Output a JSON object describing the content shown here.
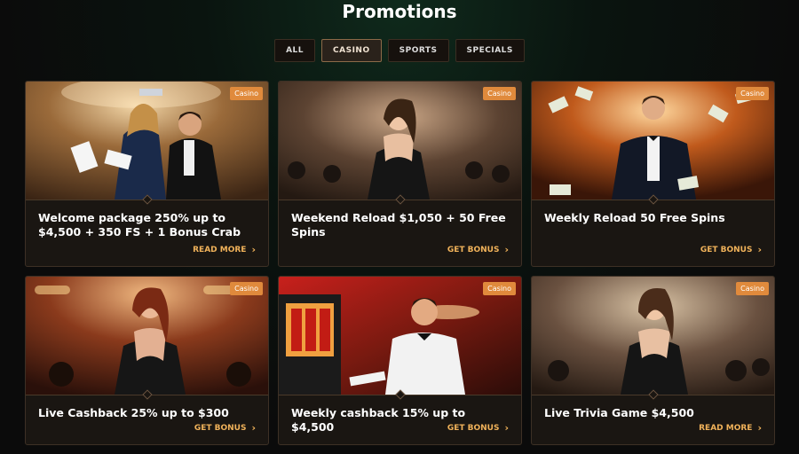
{
  "page": {
    "title": "Promotions"
  },
  "tabs": [
    {
      "label": "ALL"
    },
    {
      "label": "CASINO"
    },
    {
      "label": "SPORTS"
    },
    {
      "label": "SPECIALS"
    }
  ],
  "cards": [
    {
      "badge": "Casino",
      "title": "Welcome package 250% up to $4,500 + 350 FS + 1 Bonus Crab",
      "action": "READ MORE"
    },
    {
      "badge": "Casino",
      "title": "Weekend Reload $1,050 + 50 Free Spins",
      "action": "GET BONUS"
    },
    {
      "badge": "Casino",
      "title": "Weekly Reload 50 Free Spins",
      "action": "GET BONUS"
    },
    {
      "badge": "Casino",
      "title": "Live Cashback 25% up to $300",
      "action": "GET BONUS"
    },
    {
      "badge": "Casino",
      "title": "Weekly cashback 15% up to $4,500",
      "action": "GET BONUS"
    },
    {
      "badge": "Casino",
      "title": "Live Trivia Game $4,500",
      "action": "READ MORE"
    }
  ]
}
